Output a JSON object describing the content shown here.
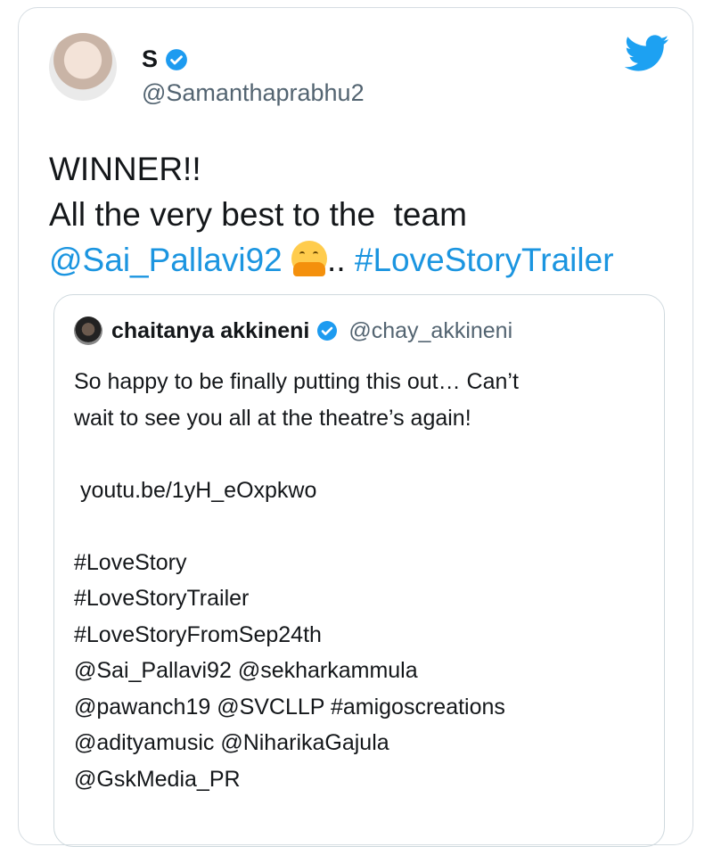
{
  "tweet": {
    "author_name": "S",
    "author_handle": "@Samanthaprabhu2",
    "line1": "WINNER!!",
    "line2": "All the very best to the  team",
    "mention": "@Sai_Pallavi92",
    "separator": "..",
    "hashtag": "#LoveStoryTrailer",
    "emoji": "hugging-face-emoji"
  },
  "quote": {
    "author_name": "chaitanya akkineni",
    "author_handle": "@chay_akkineni",
    "lines": [
      "So happy to be finally putting this out… Can’t",
      "wait to see you all at the theatre’s again!",
      "",
      " youtu.be/1yH_eOxpkwo",
      "",
      "#LoveStory",
      "#LoveStoryTrailer",
      "#LoveStoryFromSep24th",
      "@Sai_Pallavi92 @sekharkammula",
      "@pawanch19 @SVCLLP #amigoscreations",
      "@adityamusic @NiharikaGajula",
      "@GskMedia_PR"
    ]
  },
  "colors": {
    "link": "#1b95e0",
    "verified": "#1d9bf0",
    "twitter_brand": "#1da1f2",
    "secondary_text": "#536471",
    "border": "#d6dde2"
  }
}
